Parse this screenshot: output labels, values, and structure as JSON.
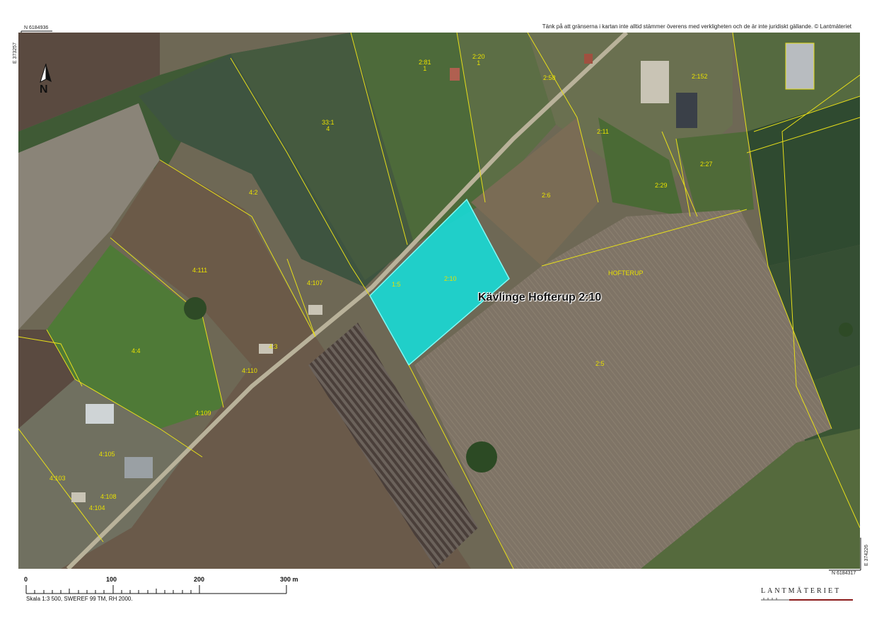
{
  "coords": {
    "top_left_north": "N 6184936",
    "top_left_east": "E 373257",
    "bottom_right_north": "N 6184317",
    "bottom_right_east": "E 374226"
  },
  "disclaimer": "Tänk på att gränserna i kartan inte alltid stämmer överens med verkligheten och de är inte juridiskt gällande. © Lantmäteriet",
  "north_label": "N",
  "property_title": "Kävlinge Hofterup 2:10",
  "parcels": [
    {
      "line1": "2:81",
      "line2": "1"
    },
    {
      "line1": "2:20",
      "line2": "1"
    },
    {
      "line1": "2:58",
      "line2": ""
    },
    {
      "line1": "2:152",
      "line2": ""
    },
    {
      "line1": "33:1",
      "line2": "4"
    },
    {
      "line1": "2:11",
      "line2": ""
    },
    {
      "line1": "2:27",
      "line2": ""
    },
    {
      "line1": "4:2",
      "line2": ""
    },
    {
      "line1": "2:6",
      "line2": ""
    },
    {
      "line1": "2:29",
      "line2": ""
    },
    {
      "line1": "4:111",
      "line2": ""
    },
    {
      "line1": "4:107",
      "line2": ""
    },
    {
      "line1": "1:5",
      "line2": ""
    },
    {
      "line1": "2:10",
      "line2": ""
    },
    {
      "line1": "HOFTERUP",
      "line2": ""
    },
    {
      "line1": "4:4",
      "line2": ""
    },
    {
      "line1": "4:3",
      "line2": ""
    },
    {
      "line1": "4:110",
      "line2": ""
    },
    {
      "line1": "2:5",
      "line2": ""
    },
    {
      "line1": "4:109",
      "line2": ""
    },
    {
      "line1": "4:105",
      "line2": ""
    },
    {
      "line1": "4:103",
      "line2": ""
    },
    {
      "line1": "4:108",
      "line2": ""
    },
    {
      "line1": "4:104",
      "line2": ""
    }
  ],
  "scale": {
    "ticks": [
      "0",
      "100",
      "200",
      "300 m"
    ],
    "caption": "Skala 1:3 500, SWEREF 99 TM, RH 2000."
  },
  "logo": "LANTMÄTERIET",
  "colors": {
    "highlight": "#19d8d4",
    "boundary": "#e6de1a",
    "label": "#e8e000"
  }
}
